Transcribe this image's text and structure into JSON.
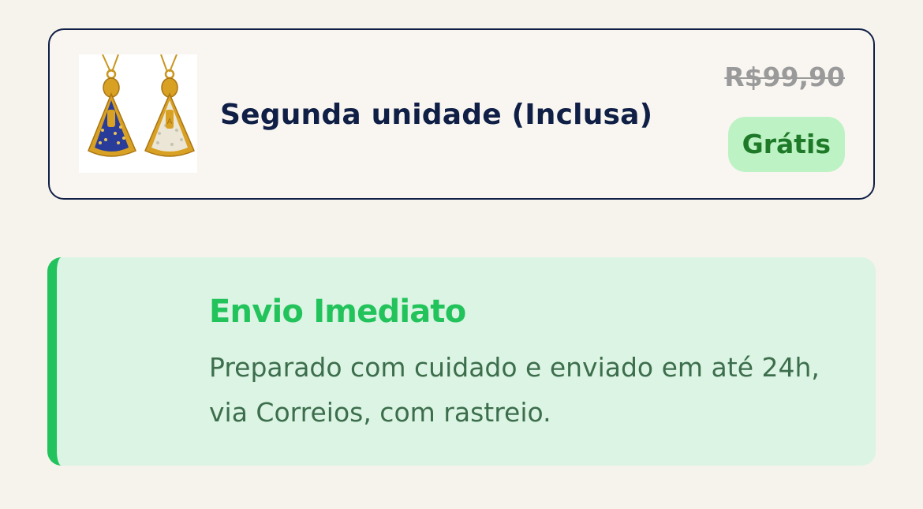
{
  "product": {
    "image_alt": "Pingentes Nossa Senhora Aparecida",
    "title": "Segunda unidade (Inclusa)",
    "old_price": "R$99,90",
    "badge": "Grátis"
  },
  "shipping": {
    "title": "Envio Imediato",
    "description": "Preparado com cuidado e enviado em até 24h, via Correios, com rastreio."
  },
  "colors": {
    "background": "#f6f2ec",
    "card_border": "#0f1f45",
    "badge_bg": "#bdf2c4",
    "badge_text": "#1e7a28",
    "ship_bg": "#dcf4e4",
    "ship_accent": "#22c25c"
  }
}
